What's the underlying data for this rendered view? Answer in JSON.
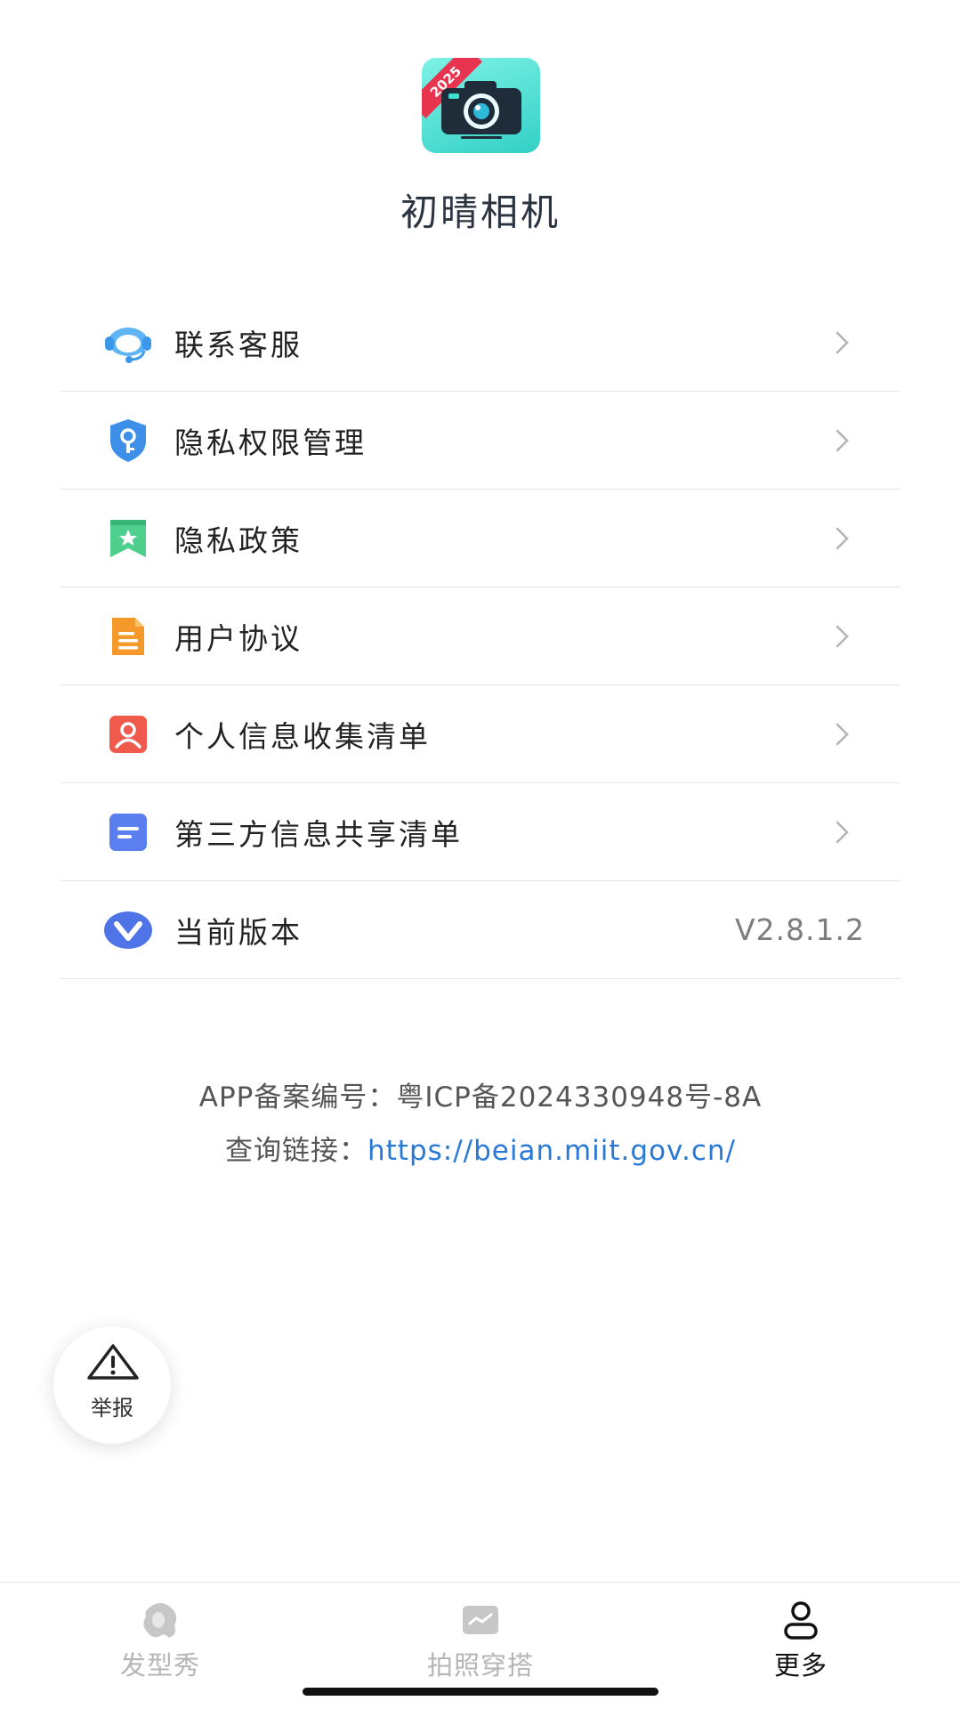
{
  "app": {
    "name": "初晴相机",
    "logo_badge": "2025",
    "accent_color": "#33d0c6"
  },
  "menu": {
    "items": [
      {
        "label": "联系客服",
        "icon": "customer-service-icon"
      },
      {
        "label": "隐私权限管理",
        "icon": "shield-key-icon"
      },
      {
        "label": "隐私政策",
        "icon": "bookmark-star-icon"
      },
      {
        "label": "用户协议",
        "icon": "document-icon"
      },
      {
        "label": "个人信息收集清单",
        "icon": "person-card-icon"
      },
      {
        "label": "第三方信息共享清单",
        "icon": "list-doc-icon"
      },
      {
        "label": "当前版本",
        "icon": "version-v-icon",
        "value": "V2.8.1.2"
      }
    ]
  },
  "record": {
    "line1": "APP备案编号：粤ICP备2024330948号-8A",
    "query_label": "查询链接：",
    "query_link": "https://beian.miit.gov.cn/",
    "link_color": "#2979d6"
  },
  "report": {
    "label": "举报",
    "icon": "warning-triangle-icon"
  },
  "tabbar": {
    "tabs": [
      {
        "label": "发型秀",
        "icon": "hairstyle-icon",
        "active": false
      },
      {
        "label": "拍照穿搭",
        "icon": "photo-icon",
        "active": false
      },
      {
        "label": "更多",
        "icon": "person-icon",
        "active": true
      }
    ]
  }
}
